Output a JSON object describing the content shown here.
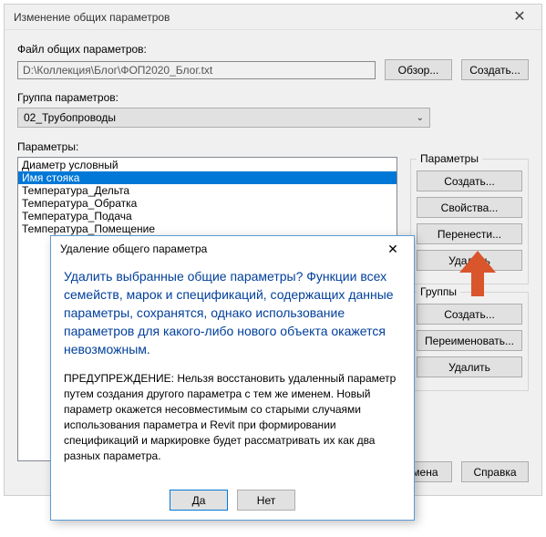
{
  "main": {
    "title": "Изменение общих параметров",
    "file_label": "Файл общих параметров:",
    "file_path": "D:\\Коллекция\\Блог\\ФОП2020_Блог.txt",
    "browse": "Обзор...",
    "create": "Создать...",
    "group_label": "Группа параметров:",
    "group_value": "02_Трубопроводы",
    "params_label": "Параметры:",
    "params": [
      "Диаметр условный",
      "Имя стояка",
      "Температура_Дельта",
      "Температура_Обратка",
      "Температура_Подача",
      "Температура_Помещение"
    ],
    "selected_index": 1,
    "side": {
      "group1_title": "Параметры",
      "g1_new": "Создать...",
      "g1_props": "Свойства...",
      "g1_move": "Перенести...",
      "g1_delete": "Удалить",
      "group2_title": "Группы",
      "g2_new": "Создать...",
      "g2_rename": "Переименовать...",
      "g2_delete": "Удалить"
    },
    "cancel": "Отмена",
    "help": "Справка"
  },
  "modal": {
    "title": "Удаление общего параметра",
    "msg": "Удалить выбранные общие параметры? Функции всех семейств, марок и спецификаций, содержащих данные параметры, сохранятся, однако использование параметров для какого-либо нового объекта окажется невозможным.",
    "warn": "ПРЕДУПРЕЖДЕНИЕ: Нельзя восстановить удаленный параметр путем создания другого параметра с тем же именем.  Новый параметр окажется несовместимым со старыми случаями использования параметра и Revit при формировании спецификаций и маркировке будет рассматривать их как два разных параметра.",
    "yes": "Да",
    "no": "Нет"
  }
}
